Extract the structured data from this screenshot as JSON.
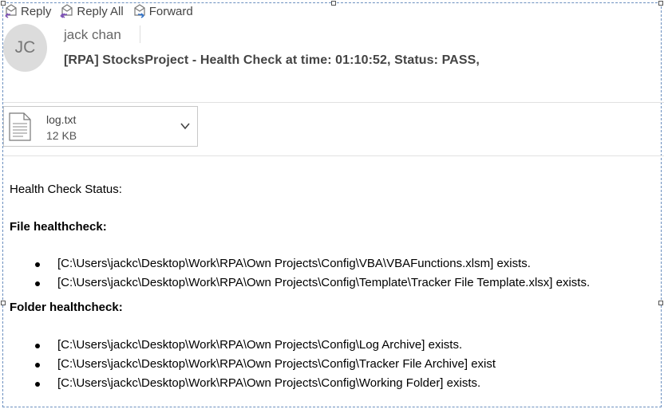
{
  "toolbar": {
    "reply": "Reply",
    "reply_all": "Reply All",
    "forward": "Forward"
  },
  "message": {
    "avatar_initials": "JC",
    "sender": "jack chan",
    "subject": "[RPA] StocksProject - Health Check at time: 01:10:52, Status: PASS,"
  },
  "attachment": {
    "name": "log.txt",
    "size": "12 KB"
  },
  "body": {
    "intro": "Health Check Status:",
    "file_section": {
      "title": "File healthcheck:",
      "items": [
        "[C:\\Users\\jackc\\Desktop\\Work\\RPA\\Own Projects\\Config\\VBA\\VBAFunctions.xlsm] exists.",
        "[C:\\Users\\jackc\\Desktop\\Work\\RPA\\Own Projects\\Config\\Template\\Tracker File Template.xlsx] exists."
      ]
    },
    "folder_section": {
      "title": "Folder healthcheck:",
      "items": [
        "[C:\\Users\\jackc\\Desktop\\Work\\RPA\\Own Projects\\Config\\Log Archive] exists.",
        "[C:\\Users\\jackc\\Desktop\\Work\\RPA\\Own Projects\\Config\\Tracker File Archive] exist",
        "[C:\\Users\\jackc\\Desktop\\Work\\RPA\\Own Projects\\Config\\Working Folder] exists."
      ]
    }
  }
}
